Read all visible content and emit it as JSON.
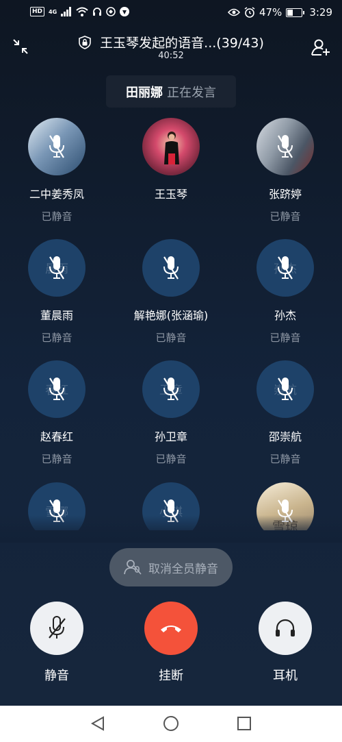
{
  "status_bar": {
    "hd": "HD",
    "network": "4G",
    "battery": "47%",
    "battery_level": 0.47,
    "time": "3:29",
    "icons": [
      "signal-icon",
      "wifi-icon",
      "headset-icon",
      "notification-icon",
      "app-icon",
      "eye-icon",
      "alarm-icon",
      "battery-icon"
    ]
  },
  "header": {
    "title": "王玉琴发起的语音...(39/43)",
    "timer": "40:52"
  },
  "speaker": {
    "name": "田丽娜",
    "state": "正在发言"
  },
  "members": [
    {
      "name": "二中姜秀凤",
      "state": "已静音",
      "ghost": ""
    },
    {
      "name": "王玉琴",
      "state": "",
      "ghost": ""
    },
    {
      "name": "张跻婷",
      "state": "已静音",
      "ghost": ""
    },
    {
      "name": "董晨雨",
      "state": "已静音",
      "ghost": "晨雨"
    },
    {
      "name": "解艳娜(张涵瑜)",
      "state": "已静音",
      "ghost": ""
    },
    {
      "name": "孙杰",
      "state": "已静音",
      "ghost": "孙杰"
    },
    {
      "name": "赵春红",
      "state": "已静音",
      "ghost": "春红"
    },
    {
      "name": "孙卫章",
      "state": "已静音",
      "ghost": "卫章"
    },
    {
      "name": "邵崇航",
      "state": "已静音",
      "ghost": "崇航"
    },
    {
      "name": "",
      "state": "",
      "ghost": "雪娜"
    },
    {
      "name": "",
      "state": "",
      "ghost": "小琪"
    },
    {
      "name": "",
      "state": "",
      "ghost": "雪琼"
    }
  ],
  "unmute_all": {
    "label": "取消全员静音"
  },
  "controls": {
    "mute": "静音",
    "hangup": "挂断",
    "headset": "耳机"
  },
  "colors": {
    "hangup": "#f4523a",
    "avatar_bg": "#1e4269",
    "background": "#0f1b2b"
  }
}
